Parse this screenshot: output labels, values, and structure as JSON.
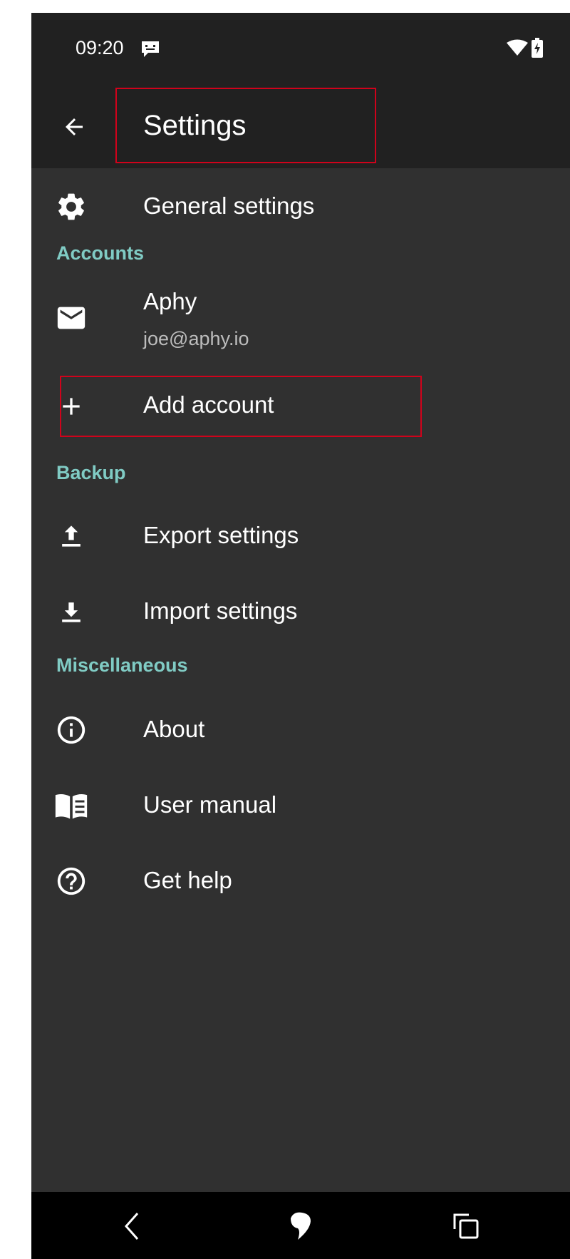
{
  "status_bar": {
    "time": "09:20"
  },
  "app_bar": {
    "title": "Settings"
  },
  "general": {
    "label": "General settings"
  },
  "sections": {
    "accounts": "Accounts",
    "backup": "Backup",
    "misc": "Miscellaneous"
  },
  "account": {
    "name": "Aphy",
    "email": "joe@aphy.io"
  },
  "add_account": {
    "label": "Add account"
  },
  "backup_items": {
    "export": "Export settings",
    "import": "Import settings"
  },
  "misc_items": {
    "about": "About",
    "manual": "User manual",
    "help": "Get help"
  },
  "colors": {
    "accent": "#80cbc4",
    "background": "#303030",
    "appbar": "#212121",
    "highlight": "#d0021b"
  }
}
